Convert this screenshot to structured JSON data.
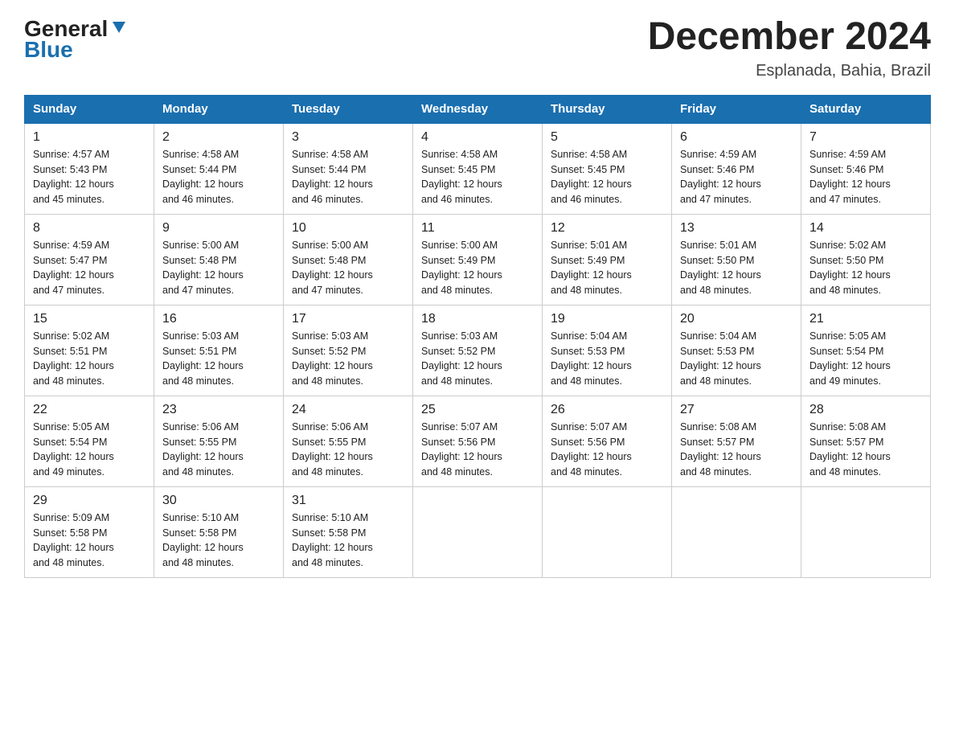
{
  "header": {
    "logo_general": "General",
    "logo_blue": "Blue",
    "month_title": "December 2024",
    "location": "Esplanada, Bahia, Brazil"
  },
  "weekdays": [
    "Sunday",
    "Monday",
    "Tuesday",
    "Wednesday",
    "Thursday",
    "Friday",
    "Saturday"
  ],
  "weeks": [
    [
      {
        "day": "1",
        "sunrise": "4:57 AM",
        "sunset": "5:43 PM",
        "daylight": "12 hours and 45 minutes."
      },
      {
        "day": "2",
        "sunrise": "4:58 AM",
        "sunset": "5:44 PM",
        "daylight": "12 hours and 46 minutes."
      },
      {
        "day": "3",
        "sunrise": "4:58 AM",
        "sunset": "5:44 PM",
        "daylight": "12 hours and 46 minutes."
      },
      {
        "day": "4",
        "sunrise": "4:58 AM",
        "sunset": "5:45 PM",
        "daylight": "12 hours and 46 minutes."
      },
      {
        "day": "5",
        "sunrise": "4:58 AM",
        "sunset": "5:45 PM",
        "daylight": "12 hours and 46 minutes."
      },
      {
        "day": "6",
        "sunrise": "4:59 AM",
        "sunset": "5:46 PM",
        "daylight": "12 hours and 47 minutes."
      },
      {
        "day": "7",
        "sunrise": "4:59 AM",
        "sunset": "5:46 PM",
        "daylight": "12 hours and 47 minutes."
      }
    ],
    [
      {
        "day": "8",
        "sunrise": "4:59 AM",
        "sunset": "5:47 PM",
        "daylight": "12 hours and 47 minutes."
      },
      {
        "day": "9",
        "sunrise": "5:00 AM",
        "sunset": "5:48 PM",
        "daylight": "12 hours and 47 minutes."
      },
      {
        "day": "10",
        "sunrise": "5:00 AM",
        "sunset": "5:48 PM",
        "daylight": "12 hours and 47 minutes."
      },
      {
        "day": "11",
        "sunrise": "5:00 AM",
        "sunset": "5:49 PM",
        "daylight": "12 hours and 48 minutes."
      },
      {
        "day": "12",
        "sunrise": "5:01 AM",
        "sunset": "5:49 PM",
        "daylight": "12 hours and 48 minutes."
      },
      {
        "day": "13",
        "sunrise": "5:01 AM",
        "sunset": "5:50 PM",
        "daylight": "12 hours and 48 minutes."
      },
      {
        "day": "14",
        "sunrise": "5:02 AM",
        "sunset": "5:50 PM",
        "daylight": "12 hours and 48 minutes."
      }
    ],
    [
      {
        "day": "15",
        "sunrise": "5:02 AM",
        "sunset": "5:51 PM",
        "daylight": "12 hours and 48 minutes."
      },
      {
        "day": "16",
        "sunrise": "5:03 AM",
        "sunset": "5:51 PM",
        "daylight": "12 hours and 48 minutes."
      },
      {
        "day": "17",
        "sunrise": "5:03 AM",
        "sunset": "5:52 PM",
        "daylight": "12 hours and 48 minutes."
      },
      {
        "day": "18",
        "sunrise": "5:03 AM",
        "sunset": "5:52 PM",
        "daylight": "12 hours and 48 minutes."
      },
      {
        "day": "19",
        "sunrise": "5:04 AM",
        "sunset": "5:53 PM",
        "daylight": "12 hours and 48 minutes."
      },
      {
        "day": "20",
        "sunrise": "5:04 AM",
        "sunset": "5:53 PM",
        "daylight": "12 hours and 48 minutes."
      },
      {
        "day": "21",
        "sunrise": "5:05 AM",
        "sunset": "5:54 PM",
        "daylight": "12 hours and 49 minutes."
      }
    ],
    [
      {
        "day": "22",
        "sunrise": "5:05 AM",
        "sunset": "5:54 PM",
        "daylight": "12 hours and 49 minutes."
      },
      {
        "day": "23",
        "sunrise": "5:06 AM",
        "sunset": "5:55 PM",
        "daylight": "12 hours and 48 minutes."
      },
      {
        "day": "24",
        "sunrise": "5:06 AM",
        "sunset": "5:55 PM",
        "daylight": "12 hours and 48 minutes."
      },
      {
        "day": "25",
        "sunrise": "5:07 AM",
        "sunset": "5:56 PM",
        "daylight": "12 hours and 48 minutes."
      },
      {
        "day": "26",
        "sunrise": "5:07 AM",
        "sunset": "5:56 PM",
        "daylight": "12 hours and 48 minutes."
      },
      {
        "day": "27",
        "sunrise": "5:08 AM",
        "sunset": "5:57 PM",
        "daylight": "12 hours and 48 minutes."
      },
      {
        "day": "28",
        "sunrise": "5:08 AM",
        "sunset": "5:57 PM",
        "daylight": "12 hours and 48 minutes."
      }
    ],
    [
      {
        "day": "29",
        "sunrise": "5:09 AM",
        "sunset": "5:58 PM",
        "daylight": "12 hours and 48 minutes."
      },
      {
        "day": "30",
        "sunrise": "5:10 AM",
        "sunset": "5:58 PM",
        "daylight": "12 hours and 48 minutes."
      },
      {
        "day": "31",
        "sunrise": "5:10 AM",
        "sunset": "5:58 PM",
        "daylight": "12 hours and 48 minutes."
      },
      null,
      null,
      null,
      null
    ]
  ],
  "labels": {
    "sunrise": "Sunrise:",
    "sunset": "Sunset:",
    "daylight": "Daylight:"
  },
  "colors": {
    "header_bg": "#1a6faf",
    "header_text": "#ffffff",
    "border": "#cccccc",
    "accent": "#1a6faf"
  }
}
